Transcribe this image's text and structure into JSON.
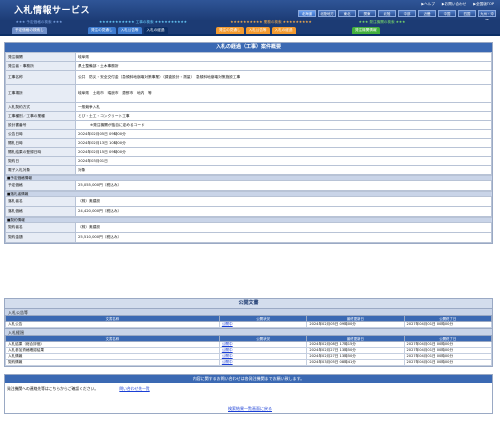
{
  "header": {
    "title": "入札情報サービス",
    "links": [
      "▶ヘルプ",
      "▶お問い合わせ",
      "▶全国版TOP"
    ],
    "regions": [
      {
        "label": "北海道",
        "active": true
      },
      {
        "label": "北陸地方",
        "active": false
      },
      {
        "label": "東北",
        "active": false
      },
      {
        "label": "関東",
        "active": false
      },
      {
        "label": "北陸",
        "active": false
      },
      {
        "label": "中部",
        "active": false
      },
      {
        "label": "近畿",
        "active": false
      },
      {
        "label": "中国",
        "active": false
      },
      {
        "label": "四国",
        "active": false
      },
      {
        "label": "九州・沖縄",
        "active": false
      }
    ]
  },
  "nav": {
    "groups": [
      {
        "title": "★★★ 予定価格の検索 ★★★",
        "tabs": [
          "予定価格の検索し"
        ]
      },
      {
        "title": "★★★★★★★★★★★ 工事の検索 ★★★★★★★★★★",
        "tabs": [
          "発注の見通し",
          "入札公告等",
          "入札の経過"
        ],
        "active": 2
      },
      {
        "title": "★★★★★★★★★★ 業務の検索 ★★★★★★★★★",
        "tabs": [
          "発注の見通し",
          "入札公告等",
          "入札の経過"
        ]
      },
      {
        "title": "★★★ 発注機関の検索 ★★★",
        "tabs": [
          "発注機関情報"
        ]
      }
    ]
  },
  "detail": {
    "title": "入札の経過（工事）案件概要",
    "rows": [
      {
        "k": "発注機関",
        "v": "岐阜県"
      },
      {
        "k": "発注者・事務所",
        "v": "県土整備部・土木事務所"
      },
      {
        "k": "工事名称",
        "v": "公共　防災・安全交付金（急傾斜地崩壊対策事業）（調査設計・測量）　急傾斜地崩壊対策施設工事"
      },
      {
        "k": "工事場所",
        "v": "岐阜県　土岐市　瑞浪市　恵那市　地内　等"
      },
      {
        "k": "入札契約方式",
        "v": "一般競争入札"
      },
      {
        "k": "工事種別／工事の業種",
        "v": "とび・土工・コンクリート工事"
      },
      {
        "k": "設計書番号",
        "v": "",
        "note": "※発注機関が独自に定めるコード"
      },
      {
        "k": "公告日時",
        "v": "2024年02月05日 09時00分"
      },
      {
        "k": "開札日時",
        "v": "2024年02月13日 10時00分"
      },
      {
        "k": "開札結果の登録日時",
        "v": "2024年02月15日 09時00分"
      },
      {
        "k": "契約日",
        "v": "2024年03月01日"
      },
      {
        "k": "電子入札対象",
        "v": "対象"
      }
    ],
    "sections": [
      {
        "title": "■予定価格情報",
        "rows": [
          {
            "k": "予定価格",
            "v": "25,055,000円（税込み）"
          }
        ]
      },
      {
        "title": "■落札者情報",
        "rows": [
          {
            "k": "落札者名",
            "v": "（株）奥建設"
          },
          {
            "k": "落札価格",
            "v": "24,420,000円（税込み）"
          }
        ]
      },
      {
        "title": "■契約情報",
        "rows": [
          {
            "k": "契約者名",
            "v": "（株）奥建設"
          },
          {
            "k": "契約金額",
            "v": "25,510,000円（税込み）"
          }
        ]
      }
    ]
  },
  "docs": {
    "title": "公開文書",
    "groups": [
      {
        "title": "入札公告等",
        "headers": [
          "文書名称",
          "公開状況",
          "最終更新日",
          "公開終了日"
        ],
        "rows": [
          {
            "name": "入札公告",
            "state": "公開中",
            "updated": "2024年02月05日 09時00分",
            "end": "2027年04月01日 00時00分"
          }
        ]
      },
      {
        "title": "入札経過",
        "headers": [
          "文書名称",
          "公開状況",
          "最終更新日",
          "公開終了日"
        ],
        "rows": [
          {
            "name": "入札結果（総合評価）",
            "state": "公開中",
            "updated": "2024年02月08日 17時15分",
            "end": "2027年04月01日 00時00分"
          },
          {
            "name": "入札参加資格確認結果",
            "state": "公開中",
            "updated": "2024年02月27日 13時50分",
            "end": "2027年04月01日 00時00分"
          },
          {
            "name": "入札情報",
            "state": "公開中",
            "updated": "2024年02月27日 13時50分",
            "end": "2027年04月01日 00時00分"
          },
          {
            "name": "契約情報",
            "state": "公開中",
            "updated": "2024年03月05日 08時41分",
            "end": "2027年04月01日 00時00分"
          }
        ]
      }
    ]
  },
  "inquiry": {
    "bar": "内容に関するお問い合わせは各発注機関までお願い致します。",
    "text": "発注機関への連絡先等はこちらからご確認ください。",
    "link": "問い合わせ先一覧"
  },
  "back_link": "検索結果一覧画面に戻る"
}
